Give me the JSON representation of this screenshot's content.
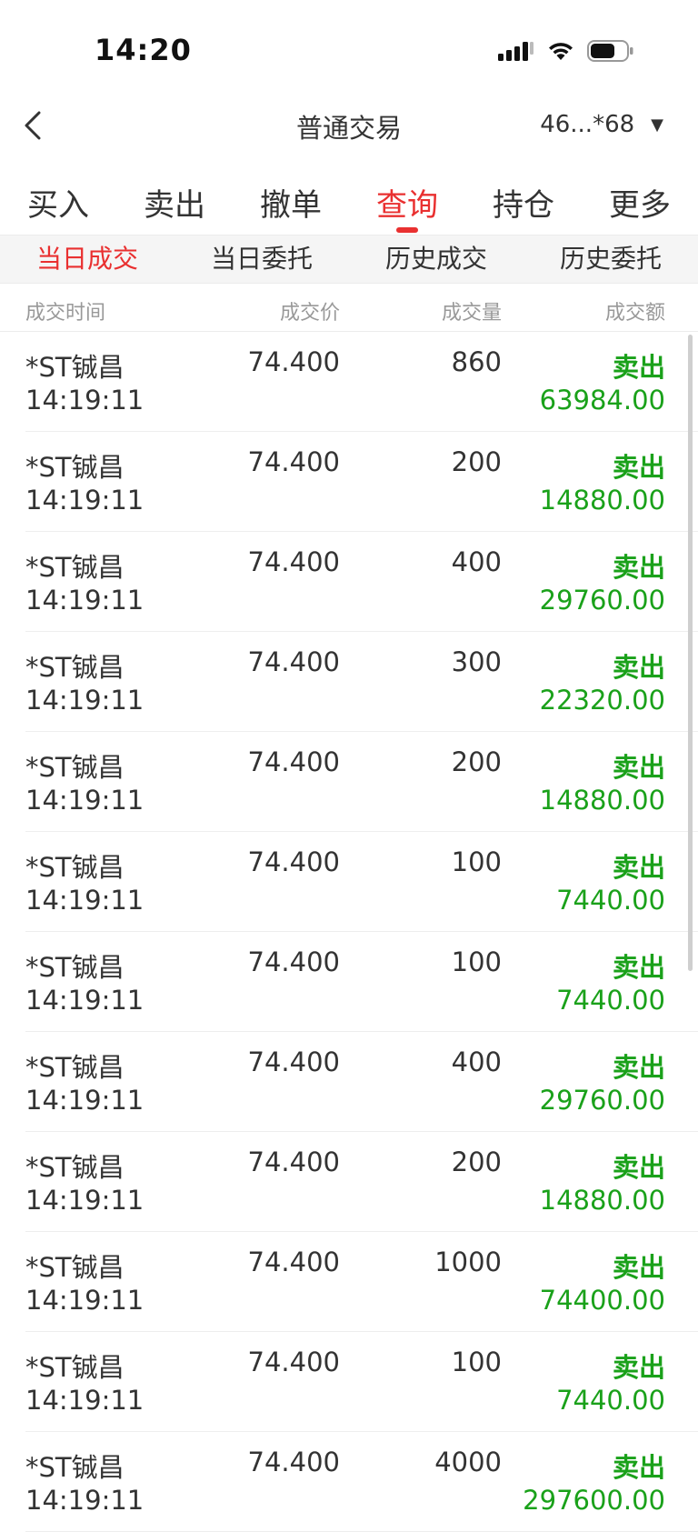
{
  "status_bar": {
    "time": "14:20"
  },
  "nav": {
    "title": "普通交易",
    "account": "46...*68",
    "caret": "▼"
  },
  "main_tabs": [
    {
      "label": "买入",
      "active": false
    },
    {
      "label": "卖出",
      "active": false
    },
    {
      "label": "撤单",
      "active": false
    },
    {
      "label": "查询",
      "active": true
    },
    {
      "label": "持仓",
      "active": false
    },
    {
      "label": "更多",
      "active": false
    }
  ],
  "sub_tabs": [
    {
      "label": "当日成交",
      "active": true
    },
    {
      "label": "当日委托",
      "active": false
    },
    {
      "label": "历史成交",
      "active": false
    },
    {
      "label": "历史委托",
      "active": false
    }
  ],
  "columns": {
    "time": "成交时间",
    "price": "成交价",
    "qty": "成交量",
    "amount": "成交额"
  },
  "colors": {
    "accent_red": "#e93030",
    "sell_green": "#1aa11a"
  },
  "trades": [
    {
      "name": "*ST铖昌",
      "time": "14:19:11",
      "price": "74.400",
      "qty": "860",
      "side": "卖出",
      "amount": "63984.00"
    },
    {
      "name": "*ST铖昌",
      "time": "14:19:11",
      "price": "74.400",
      "qty": "200",
      "side": "卖出",
      "amount": "14880.00"
    },
    {
      "name": "*ST铖昌",
      "time": "14:19:11",
      "price": "74.400",
      "qty": "400",
      "side": "卖出",
      "amount": "29760.00"
    },
    {
      "name": "*ST铖昌",
      "time": "14:19:11",
      "price": "74.400",
      "qty": "300",
      "side": "卖出",
      "amount": "22320.00"
    },
    {
      "name": "*ST铖昌",
      "time": "14:19:11",
      "price": "74.400",
      "qty": "200",
      "side": "卖出",
      "amount": "14880.00"
    },
    {
      "name": "*ST铖昌",
      "time": "14:19:11",
      "price": "74.400",
      "qty": "100",
      "side": "卖出",
      "amount": "7440.00"
    },
    {
      "name": "*ST铖昌",
      "time": "14:19:11",
      "price": "74.400",
      "qty": "100",
      "side": "卖出",
      "amount": "7440.00"
    },
    {
      "name": "*ST铖昌",
      "time": "14:19:11",
      "price": "74.400",
      "qty": "400",
      "side": "卖出",
      "amount": "29760.00"
    },
    {
      "name": "*ST铖昌",
      "time": "14:19:11",
      "price": "74.400",
      "qty": "200",
      "side": "卖出",
      "amount": "14880.00"
    },
    {
      "name": "*ST铖昌",
      "time": "14:19:11",
      "price": "74.400",
      "qty": "1000",
      "side": "卖出",
      "amount": "74400.00"
    },
    {
      "name": "*ST铖昌",
      "time": "14:19:11",
      "price": "74.400",
      "qty": "100",
      "side": "卖出",
      "amount": "7440.00"
    },
    {
      "name": "*ST铖昌",
      "time": "14:19:11",
      "price": "74.400",
      "qty": "4000",
      "side": "卖出",
      "amount": "297600.00"
    }
  ]
}
